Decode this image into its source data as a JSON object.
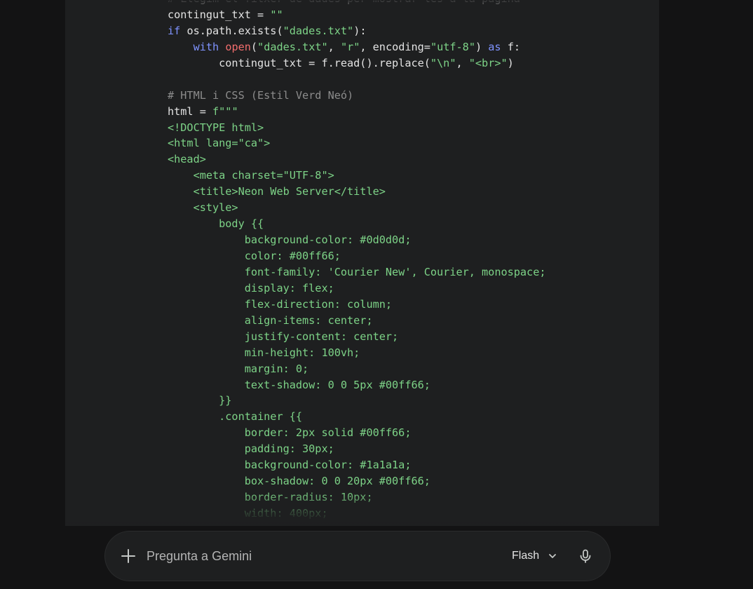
{
  "code_block": {
    "language": "python",
    "lines": [
      [
        {
          "t": "c",
          "v": "# Llegim el fitxer de dades per mostrar-les a la pàgina"
        }
      ],
      [
        {
          "t": "d",
          "v": "contingut_txt = "
        },
        {
          "t": "s",
          "v": "\"\""
        }
      ],
      [
        {
          "t": "k",
          "v": "if"
        },
        {
          "t": "d",
          "v": " os.path.exists("
        },
        {
          "t": "s",
          "v": "\"dades.txt\""
        },
        {
          "t": "d",
          "v": "):"
        }
      ],
      [
        {
          "t": "d",
          "v": "    "
        },
        {
          "t": "k",
          "v": "with"
        },
        {
          "t": "d",
          "v": " "
        },
        {
          "t": "f",
          "v": "open"
        },
        {
          "t": "d",
          "v": "("
        },
        {
          "t": "s",
          "v": "\"dades.txt\""
        },
        {
          "t": "d",
          "v": ", "
        },
        {
          "t": "s",
          "v": "\"r\""
        },
        {
          "t": "d",
          "v": ", encoding="
        },
        {
          "t": "s",
          "v": "\"utf-8\""
        },
        {
          "t": "d",
          "v": ") "
        },
        {
          "t": "k",
          "v": "as"
        },
        {
          "t": "d",
          "v": " f:"
        }
      ],
      [
        {
          "t": "d",
          "v": "        contingut_txt = f.read().replace("
        },
        {
          "t": "s",
          "v": "\"\\n\""
        },
        {
          "t": "d",
          "v": ", "
        },
        {
          "t": "s",
          "v": "\"<br>\""
        },
        {
          "t": "d",
          "v": ")"
        }
      ],
      [],
      [
        {
          "t": "c",
          "v": "# HTML i CSS (Estil Verd Neó)"
        }
      ],
      [
        {
          "t": "d",
          "v": "html = "
        },
        {
          "t": "s",
          "v": "f\"\"\""
        }
      ],
      [
        {
          "t": "s",
          "v": "<!DOCTYPE html>"
        }
      ],
      [
        {
          "t": "s",
          "v": "<html lang=\"ca\">"
        }
      ],
      [
        {
          "t": "s",
          "v": "<head>"
        }
      ],
      [
        {
          "t": "s",
          "v": "    <meta charset=\"UTF-8\">"
        }
      ],
      [
        {
          "t": "s",
          "v": "    <title>Neon Web Server</title>"
        }
      ],
      [
        {
          "t": "s",
          "v": "    <style>"
        }
      ],
      [
        {
          "t": "s",
          "v": "        body {{"
        }
      ],
      [
        {
          "t": "s",
          "v": "            background-color: #0d0d0d;"
        }
      ],
      [
        {
          "t": "s",
          "v": "            color: #00ff66;"
        }
      ],
      [
        {
          "t": "s",
          "v": "            font-family: 'Courier New', Courier, monospace;"
        }
      ],
      [
        {
          "t": "s",
          "v": "            display: flex;"
        }
      ],
      [
        {
          "t": "s",
          "v": "            flex-direction: column;"
        }
      ],
      [
        {
          "t": "s",
          "v": "            align-items: center;"
        }
      ],
      [
        {
          "t": "s",
          "v": "            justify-content: center;"
        }
      ],
      [
        {
          "t": "s",
          "v": "            min-height: 100vh;"
        }
      ],
      [
        {
          "t": "s",
          "v": "            margin: 0;"
        }
      ],
      [
        {
          "t": "s",
          "v": "            text-shadow: 0 0 5px #00ff66;"
        }
      ],
      [
        {
          "t": "s",
          "v": "        }}"
        }
      ],
      [
        {
          "t": "s",
          "v": "        .container {{"
        }
      ],
      [
        {
          "t": "s",
          "v": "            border: 2px solid #00ff66;"
        }
      ],
      [
        {
          "t": "s",
          "v": "            padding: 30px;"
        }
      ],
      [
        {
          "t": "s",
          "v": "            background-color: #1a1a1a;"
        }
      ],
      [
        {
          "t": "s",
          "v": "            box-shadow: 0 0 20px #00ff66;"
        }
      ],
      [
        {
          "t": "s",
          "v": "            border-radius: 10px;"
        }
      ],
      [
        {
          "t": "s",
          "v": "            width: 400px;"
        }
      ],
      [
        {
          "t": "s",
          "v": "        }}"
        }
      ]
    ]
  },
  "prompt_bar": {
    "placeholder": "Pregunta a Gemini",
    "add_icon": "plus-icon",
    "model_label": "Flash",
    "model_icon": "chevron-down-icon",
    "mic_icon": "microphone-icon"
  },
  "colors": {
    "background": "#131314",
    "code_background": "#1e1f20",
    "comment": "#8c8c8c",
    "keyword": "#7f93ff",
    "string": "#7dd387",
    "builtin_function": "#f26d6d",
    "default_text": "#e3e3e3"
  }
}
